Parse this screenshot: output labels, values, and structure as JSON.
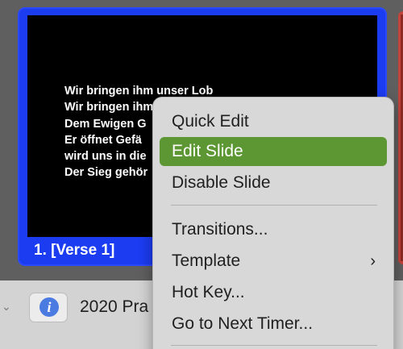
{
  "slide": {
    "lyrics": [
      "Wir bringen ihm unser Lob",
      "Wir bringen ihm unser Dank",
      "Dem Ewigen G",
      "Er öffnet Gefä",
      "wird uns in die",
      "Der Sieg gehör"
    ],
    "label": "1. [Verse 1]"
  },
  "context_menu": {
    "items": [
      {
        "label": "Quick Edit"
      },
      {
        "label": "Edit Slide"
      },
      {
        "label": "Disable Slide"
      },
      {
        "label": "Transitions..."
      },
      {
        "label": "Template"
      },
      {
        "label": "Hot Key..."
      },
      {
        "label": "Go to Next Timer..."
      }
    ]
  },
  "bottom_bar": {
    "info_icon": "i",
    "playlist_name": "2020 Pra"
  },
  "colors": {
    "slide_border": "#1c3cf2",
    "menu_highlight": "#5c9733"
  }
}
